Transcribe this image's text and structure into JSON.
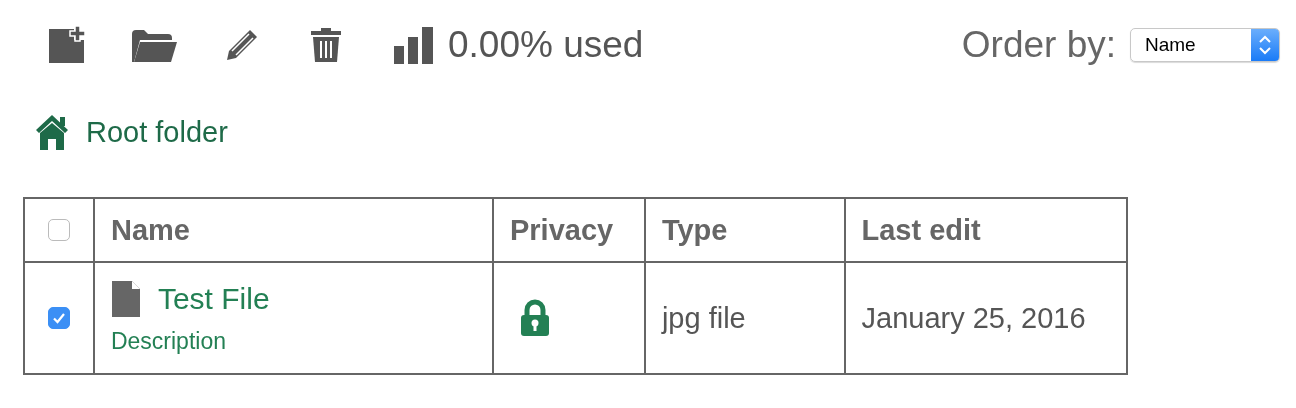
{
  "toolbar": {
    "usage": "0.00% used",
    "order_by": {
      "label": "Order by:",
      "value": "Name"
    }
  },
  "breadcrumb": {
    "label": "Root folder"
  },
  "table": {
    "select_all": {
      "checked": false
    },
    "columns": [
      "Name",
      "Privacy",
      "Type",
      "Last edit"
    ],
    "rows": [
      {
        "checked": true,
        "name": "Test File",
        "description": "Description",
        "type": "jpg file",
        "last_edit": "January 25, 2016"
      }
    ]
  }
}
